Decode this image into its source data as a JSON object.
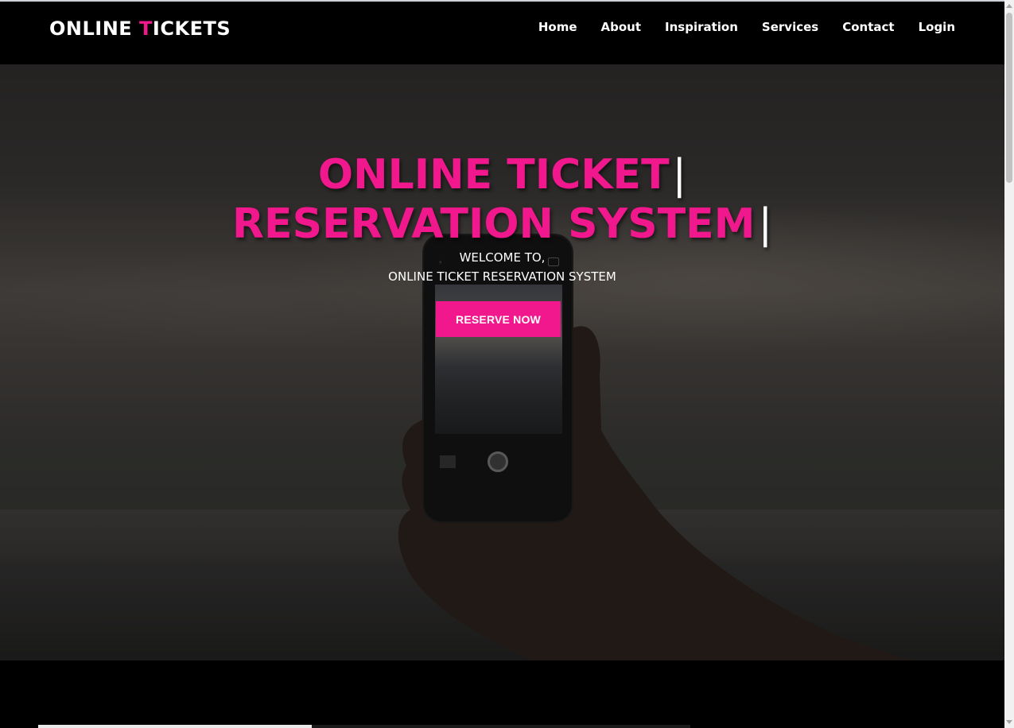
{
  "brand": {
    "prefix": "ONLINE ",
    "accent_letter": "T",
    "suffix": "ICKETS"
  },
  "nav": {
    "items": [
      {
        "label": "Home"
      },
      {
        "label": "About"
      },
      {
        "label": "Inspiration"
      },
      {
        "label": "Services"
      },
      {
        "label": "Contact"
      },
      {
        "label": "Login"
      }
    ]
  },
  "hero": {
    "title_line1": "ONLINE TICKET",
    "title_line2": "RESERVATION SYSTEM",
    "cursor": "|",
    "welcome_line1": "WELCOME TO,",
    "welcome_line2": "ONLINE TICKET RESERVATION SYSTEM",
    "button_label": "RESERVE NOW"
  },
  "colors": {
    "accent": "#f0188c",
    "navbar_bg": "#000000",
    "text": "#ffffff"
  },
  "icons": {
    "scroll_up": "scroll-up-arrow-icon",
    "scroll_down": "scroll-down-arrow-icon"
  }
}
